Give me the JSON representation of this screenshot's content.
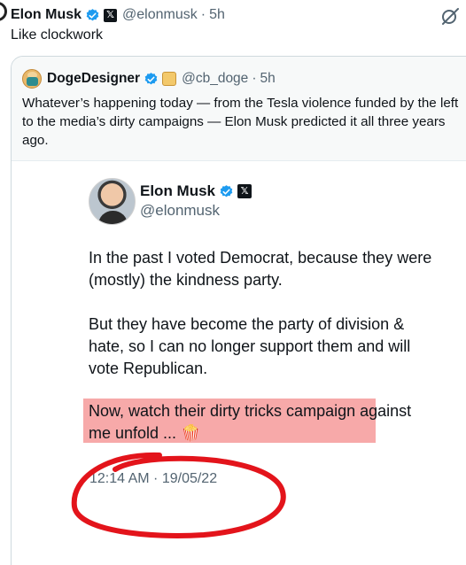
{
  "post": {
    "author_name": "Elon Musk",
    "handle": "@elonmusk",
    "dot": "·",
    "time": "5h",
    "text": "Like clockwork"
  },
  "quote": {
    "author_name": "DogeDesigner",
    "handle": "@cb_doge",
    "dot": "·",
    "time": "5h",
    "text": "Whatever’s happening today — from the Tesla violence funded by the left to the media’s dirty campaigns — Elon Musk predicted it all three years ago."
  },
  "embedded": {
    "author_name": "Elon Musk",
    "handle": "@elonmusk",
    "paragraph1": "In the past I voted Democrat, because they were (mostly) the kindness party.",
    "paragraph2": "But they have become the party of division & hate, so I can no longer support them and will vote Republican.",
    "paragraph3": "Now, watch their dirty tricks campaign against me unfold ... 🍿",
    "timestamp": "12:14 AM · 19/05/22"
  },
  "icons": {
    "verified": "verified-badge-icon",
    "x_logo": "x-logo-icon",
    "grok": "grok-icon",
    "doge": "doge-affiliate-icon"
  },
  "colors": {
    "verified_blue": "#1d9bf0",
    "highlight": "#f7a9a9",
    "annotation_red": "#e3141b",
    "secondary_text": "#536471"
  }
}
